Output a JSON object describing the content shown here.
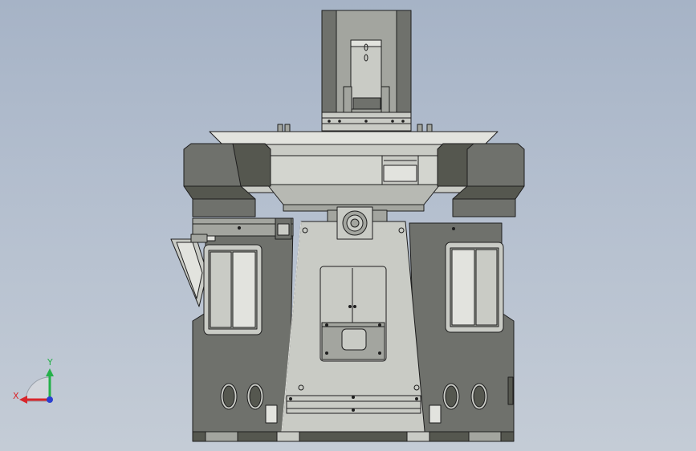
{
  "viewport": {
    "background_top": "#a6b3c6",
    "background_bottom": "#c4ccd6"
  },
  "model": {
    "colors": {
      "light_steel": "#c9cbc5",
      "mid_steel": "#a3a59f",
      "dark_steel": "#6f716c",
      "darker_steel": "#55574f",
      "outline": "#1e1e1e",
      "edge_light": "#e2e3de"
    }
  },
  "triad": {
    "x_label": "X",
    "y_label": "Y",
    "x_color": "#d8262b",
    "y_color": "#25b04a",
    "z_color": "#2a3fd0"
  }
}
